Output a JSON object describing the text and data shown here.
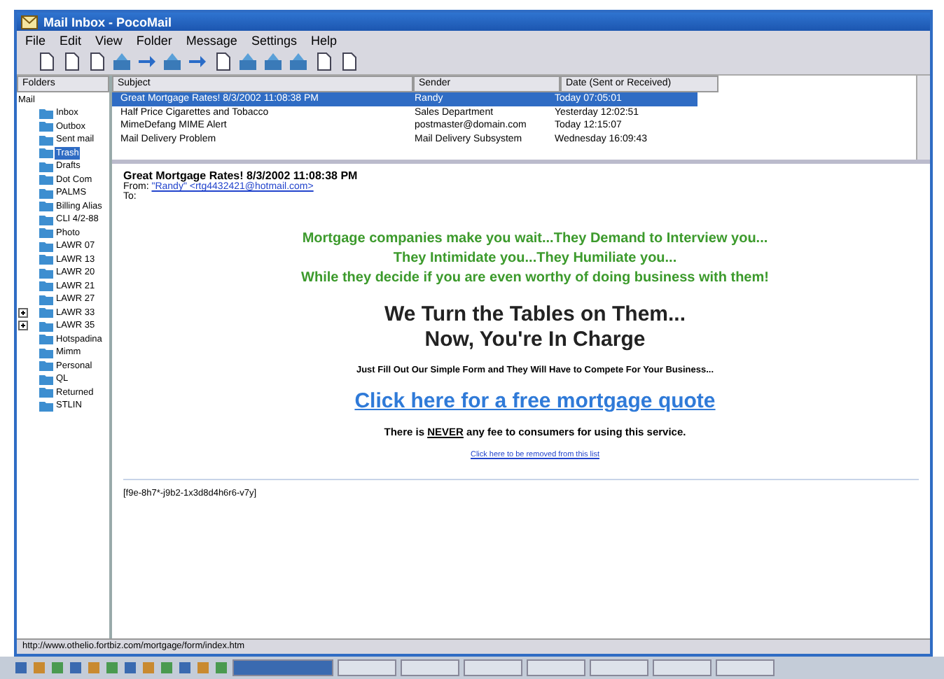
{
  "window": {
    "title": "Mail Inbox - PocoMail"
  },
  "menu": [
    "File",
    "Edit",
    "View",
    "Folder",
    "Message",
    "Settings",
    "Help"
  ],
  "folders": {
    "header": "Folders",
    "root": {
      "label": "Mail",
      "children": [
        {
          "label": "Inbox",
          "selected": false,
          "expandable": false
        },
        {
          "label": "Outbox",
          "selected": false,
          "expandable": false
        },
        {
          "label": "Sent mail",
          "selected": false,
          "expandable": false
        },
        {
          "label": "Trash",
          "selected": true,
          "expandable": false
        },
        {
          "label": "Drafts",
          "selected": false,
          "expandable": false
        },
        {
          "label": "Dot Com",
          "selected": false,
          "expandable": false
        },
        {
          "label": "PALMS",
          "selected": false,
          "expandable": false
        },
        {
          "label": "Billing Alias",
          "selected": false,
          "expandable": false
        },
        {
          "label": "CLI 4/2-88",
          "selected": false,
          "expandable": false
        },
        {
          "label": "Photo",
          "selected": false,
          "expandable": false
        },
        {
          "label": "LAWR 07",
          "selected": false,
          "expandable": false
        },
        {
          "label": "LAWR 13",
          "selected": false,
          "expandable": false
        },
        {
          "label": "LAWR 20",
          "selected": false,
          "expandable": false
        },
        {
          "label": "LAWR 21",
          "selected": false,
          "expandable": false
        },
        {
          "label": "LAWR 27",
          "selected": false,
          "expandable": false
        },
        {
          "label": "LAWR 33",
          "selected": false,
          "expandable": true
        },
        {
          "label": "LAWR 35",
          "selected": false,
          "expandable": true
        },
        {
          "label": "Hotspadina",
          "selected": false,
          "expandable": false
        },
        {
          "label": "Mimm",
          "selected": false,
          "expandable": false
        },
        {
          "label": "Personal",
          "selected": false,
          "expandable": false
        },
        {
          "label": "QL",
          "selected": false,
          "expandable": false
        },
        {
          "label": "Returned",
          "selected": false,
          "expandable": false
        },
        {
          "label": "STLIN",
          "selected": false,
          "expandable": false
        }
      ]
    }
  },
  "messages": {
    "columns": [
      "Subject",
      "Sender",
      "Date (Sent or Received)"
    ],
    "rows": [
      {
        "subject": "Great Mortgage Rates! 8/3/2002 11:08:38 PM",
        "sender": "Randy",
        "date": "Today 07:05:01",
        "selected": true
      },
      {
        "subject": "Half Price Cigarettes and Tobacco",
        "sender": "Sales Department",
        "date": "Yesterday 12:02:51",
        "selected": false
      },
      {
        "subject": "MimeDefang MIME Alert",
        "sender": "postmaster@domain.com",
        "date": "Today 12:15:07",
        "selected": false
      },
      {
        "subject": "Mail Delivery Problem",
        "sender": "Mail Delivery Subsystem",
        "date": "Wednesday 16:09:43",
        "selected": false
      }
    ]
  },
  "preview": {
    "subject": "Great Mortgage Rates! 8/3/2002 11:08:38 PM",
    "from_label": "From:",
    "from": "\"Randy\" <rtg4432421@hotmail.com>",
    "to_label": "To:",
    "green_lines": [
      "Mortgage companies make you wait...They Demand to Interview you...",
      "They Intimidate you...They Humiliate you...",
      "While they decide if you are even worthy of doing business with them!"
    ],
    "headline": [
      "We Turn the Tables on Them...",
      "Now, You're In Charge"
    ],
    "subline": "Just Fill Out Our Simple Form and They Will Have to Compete For Your Business...",
    "quote_link": "Click here for a free mortgage quote",
    "fee_note": {
      "before": "There is ",
      "emphasis": "NEVER",
      "after": " any fee to consumers for using this service."
    },
    "remove_link": "Click here to be removed from this list",
    "code": "[f9e-8h7*-j9b2-1x3d8d4h6r6-v7y]"
  },
  "status_bar": "http://www.othelio.fortbiz.com/mortgage/form/index.htm"
}
